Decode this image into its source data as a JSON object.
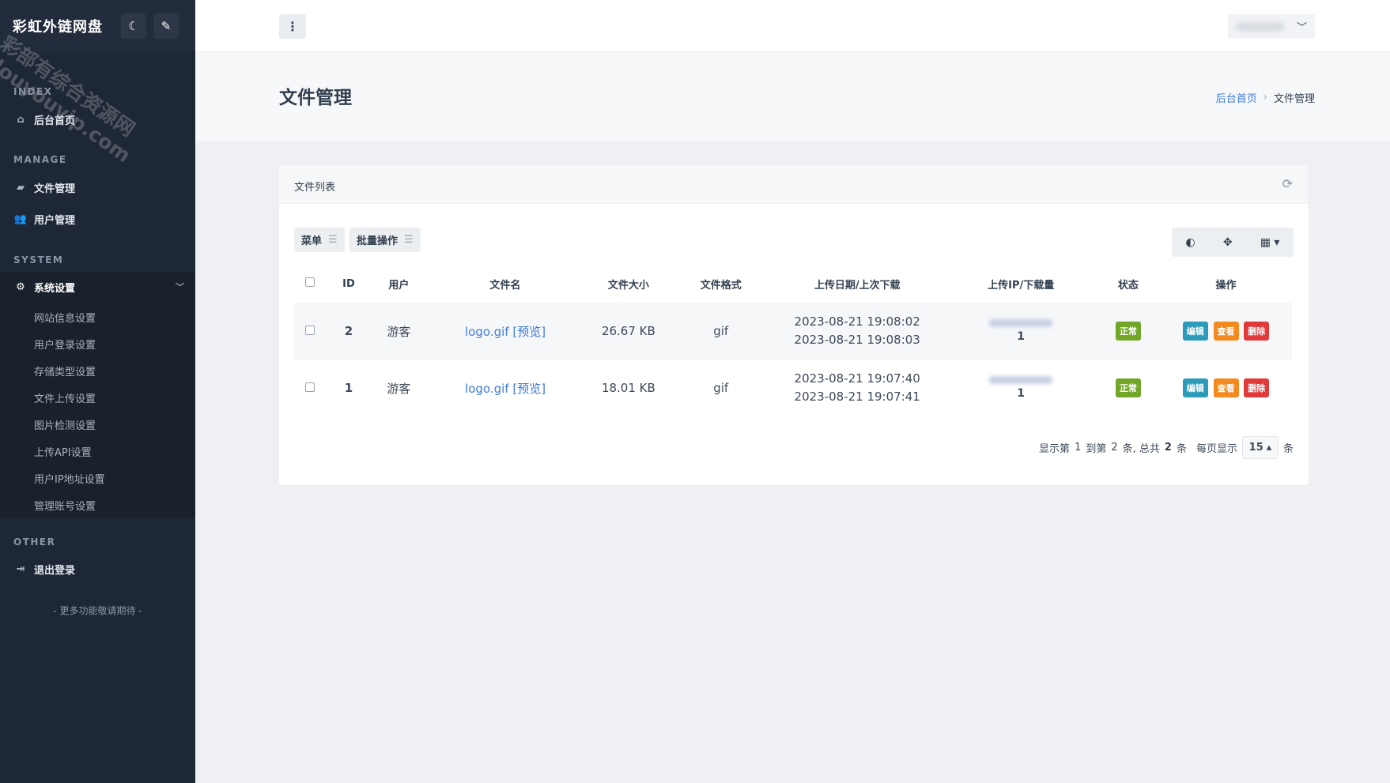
{
  "sidebar": {
    "brand": "彩虹外链网盘",
    "moon_icon": "moon-icon",
    "brush_icon": "brush-icon",
    "watermark": [
      "彩部有综合资源网",
      "douyouvip.com"
    ],
    "sections": {
      "index": "INDEX",
      "manage": "MANAGE",
      "system": "SYSTEM",
      "other": "OTHER"
    },
    "items": {
      "home": "后台首页",
      "files": "文件管理",
      "users": "用户管理",
      "settings": "系统设置",
      "logout": "退出登录"
    },
    "sub_items": [
      "网站信息设置",
      "用户登录设置",
      "存储类型设置",
      "文件上传设置",
      "图片检测设置",
      "上传API设置",
      "用户IP地址设置",
      "管理账号设置"
    ],
    "footer_note": "- 更多功能敬请期待 -"
  },
  "header": {
    "menu_icon": "more-vertical-icon"
  },
  "page": {
    "title": "文件管理",
    "breadcrumb": {
      "home": "后台首页",
      "current": "文件管理"
    }
  },
  "card": {
    "title": "文件列表",
    "toolbar": {
      "menu": "菜单",
      "batch": "批量操作"
    },
    "columns": [
      "ID",
      "用户",
      "文件名",
      "文件大小",
      "文件格式",
      "上传日期/上次下载",
      "上传IP/下载量",
      "状态",
      "操作"
    ],
    "rows": [
      {
        "id": "2",
        "user": "游客",
        "filename": "logo.gif",
        "preview": "[预览]",
        "size": "26.67 KB",
        "format": "gif",
        "upload_date": "2023-08-21 19:08:02",
        "last_download": "2023-08-21 19:08:03",
        "downloads": "1",
        "status": "正常"
      },
      {
        "id": "1",
        "user": "游客",
        "filename": "logo.gif",
        "preview": "[预览]",
        "size": "18.01 KB",
        "format": "gif",
        "upload_date": "2023-08-21 19:07:40",
        "last_download": "2023-08-21 19:07:41",
        "downloads": "1",
        "status": "正常"
      }
    ],
    "actions": {
      "edit": "编辑",
      "view": "查看",
      "delete": "删除"
    },
    "pagination": {
      "prefix": "显示第",
      "from": "1",
      "mid": "到第",
      "to": "2",
      "unit1": "条, 总共",
      "total": "2",
      "unit2": "条",
      "per_page_label": "每页显示",
      "per_page": "15",
      "suffix": "条"
    }
  },
  "colors": {
    "sidebar": "#1e2735",
    "link": "#3d7bd6",
    "green": "#72a628",
    "blue": "#2c9bb9",
    "orange": "#f28a20",
    "red": "#e03a3a"
  }
}
